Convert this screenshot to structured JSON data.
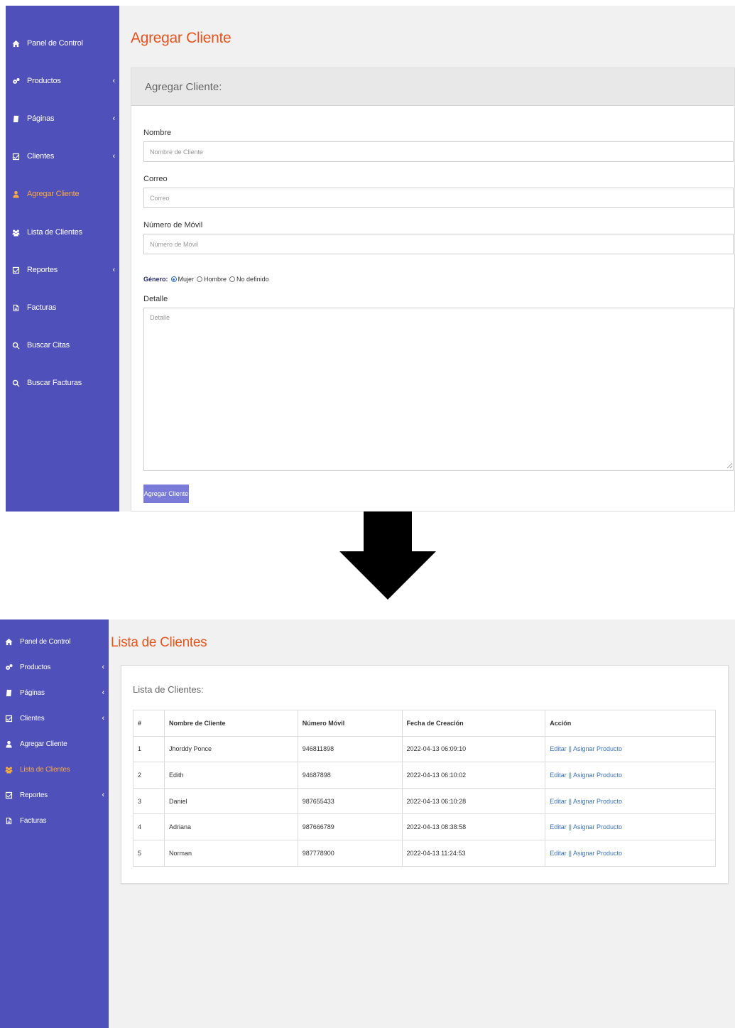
{
  "screen1": {
    "sidebar": {
      "items": [
        {
          "label": "Panel de Control",
          "icon": "home-icon"
        },
        {
          "label": "Productos",
          "icon": "gears-icon",
          "chevron": "‹"
        },
        {
          "label": "Páginas",
          "icon": "book-icon",
          "chevron": "‹"
        },
        {
          "label": "Clientes",
          "icon": "checkbox-icon",
          "chevron": "‹"
        },
        {
          "label": "Agregar Cliente",
          "icon": "user-icon",
          "active": true
        },
        {
          "label": "Lista de Clientes",
          "icon": "users-icon"
        },
        {
          "label": "Reportes",
          "icon": "checkbox-icon",
          "chevron": "‹"
        },
        {
          "label": "Facturas",
          "icon": "invoice-icon"
        },
        {
          "label": "Buscar Citas",
          "icon": "search-icon"
        },
        {
          "label": "Buscar Facturas",
          "icon": "search-icon"
        }
      ]
    },
    "page_title": "Agregar Cliente",
    "panel_title": "Agregar Cliente:",
    "form": {
      "nombre_label": "Nombre",
      "nombre_placeholder": "Nombre de Cliente",
      "correo_label": "Correo",
      "correo_placeholder": "Correo",
      "movil_label": "Número de Móvil",
      "movil_placeholder": "Número de Móvil",
      "genero_label": "Género:",
      "genero_options": [
        "Mujer",
        "Hombre",
        "No definido"
      ],
      "genero_selected": "Mujer",
      "detalle_label": "Detalle",
      "detalle_placeholder": "Detalle",
      "submit_label": "Agregar Cliente"
    }
  },
  "screen2": {
    "sidebar": {
      "items": [
        {
          "label": "Panel de Control",
          "icon": "home-icon"
        },
        {
          "label": "Productos",
          "icon": "gears-icon",
          "chevron": "‹"
        },
        {
          "label": "Páginas",
          "icon": "book-icon",
          "chevron": "‹"
        },
        {
          "label": "Clientes",
          "icon": "checkbox-icon",
          "chevron": "‹"
        },
        {
          "label": "Agregar Cliente",
          "icon": "user-icon"
        },
        {
          "label": "Lista de Clientes",
          "icon": "users-icon",
          "active": true
        },
        {
          "label": "Reportes",
          "icon": "checkbox-icon",
          "chevron": "‹"
        },
        {
          "label": "Facturas",
          "icon": "invoice-icon"
        }
      ]
    },
    "page_title": "Lista de Clientes",
    "panel_title": "Lista de Clientes:",
    "table": {
      "headers": [
        "#",
        "Nombre de Cliente",
        "Número Móvil",
        "Fecha de Creación",
        "Acción"
      ],
      "rows": [
        [
          "1",
          "Jhorddy Ponce",
          "946811898",
          "2022-04-13 06:09:10",
          "Editar || Asignar Producto"
        ],
        [
          "2",
          "Edith",
          "94687898",
          "2022-04-13 06:10:02",
          "Editar || Asignar Producto"
        ],
        [
          "3",
          "Daniel",
          "987655433",
          "2022-04-13 06:10:28",
          "Editar || Asignar Producto"
        ],
        [
          "4",
          "Adriana",
          "987666789",
          "2022-04-13 08:38:58",
          "Editar || Asignar Producto"
        ],
        [
          "5",
          "Norman",
          "987778900",
          "2022-04-13 11:24:53",
          "Editar || Asignar Producto"
        ]
      ]
    }
  },
  "colors": {
    "sidebar_bg": "#5050bb",
    "active_item": "#f8a93e",
    "page_title": "#e8541e",
    "button_bg": "#7a7bd8",
    "link": "#3d74c2",
    "content_bg": "#f1f1f1"
  }
}
